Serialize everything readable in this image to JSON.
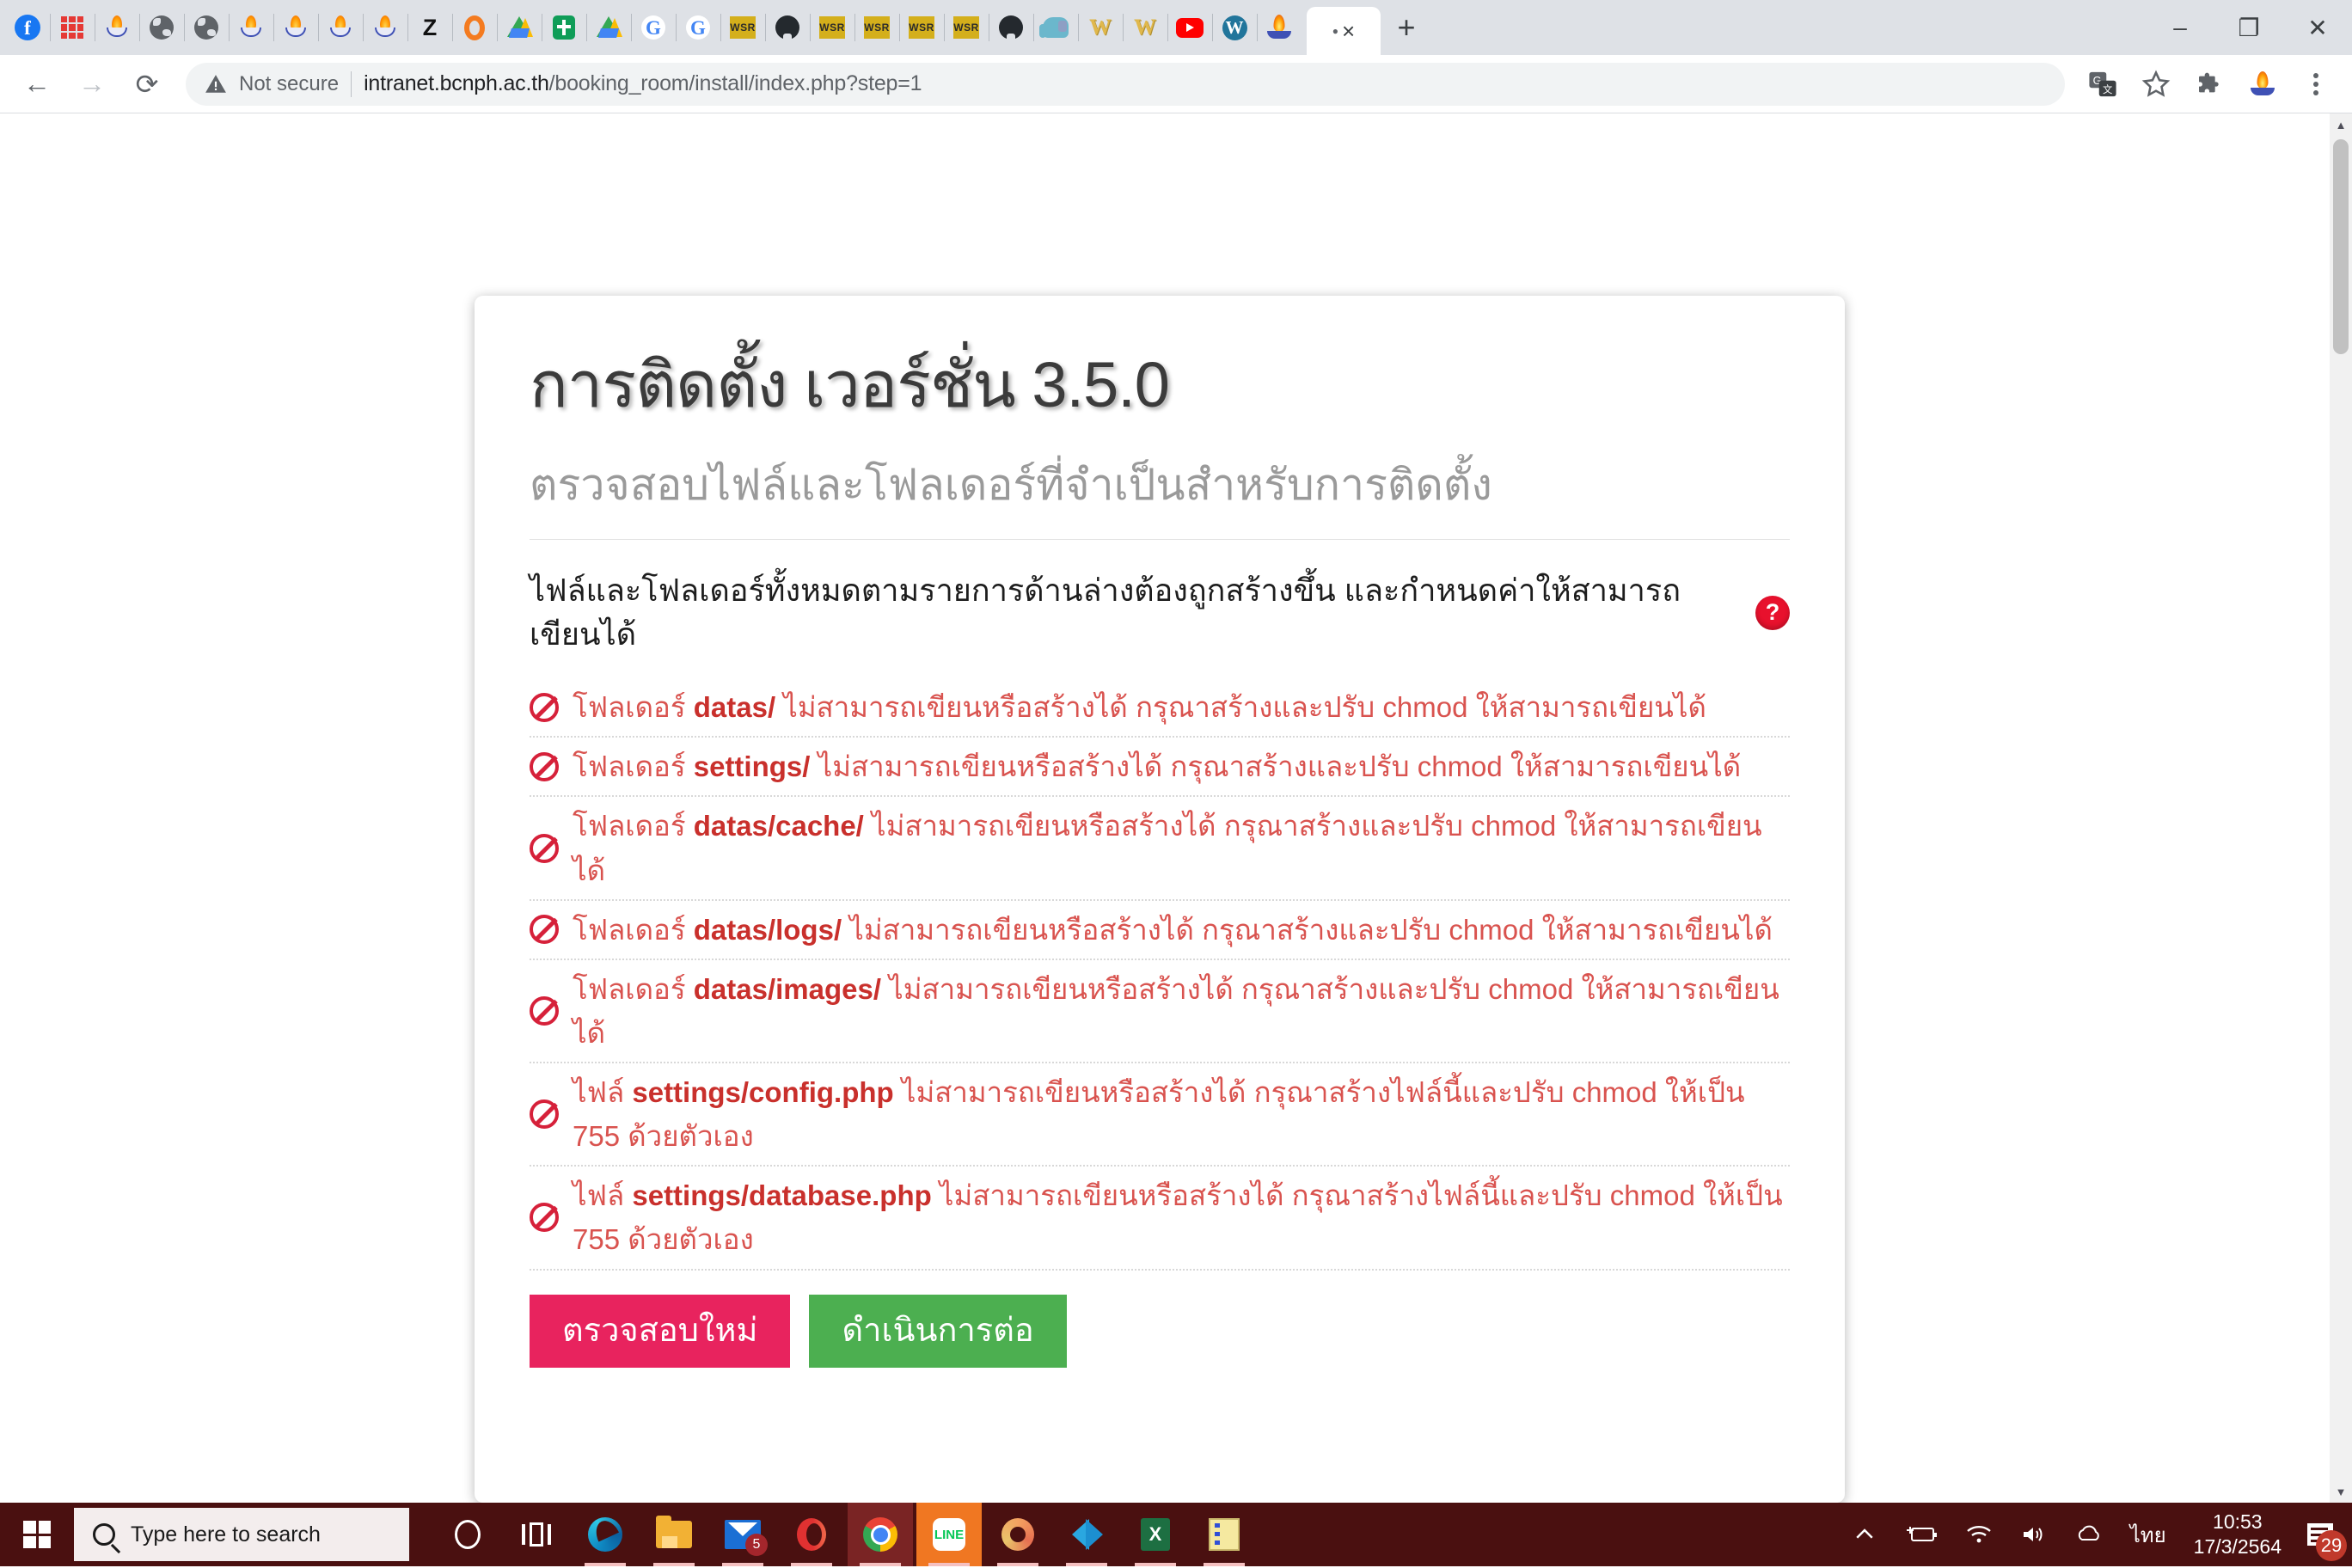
{
  "browser": {
    "pinned_tabs": [
      {
        "name": "facebook",
        "icon": "facebook-icon"
      },
      {
        "name": "grid",
        "icon": "red-grid-icon"
      },
      {
        "name": "thai-lamp-1",
        "icon": "thai-lamp-icon"
      },
      {
        "name": "globe-1",
        "icon": "globe-icon"
      },
      {
        "name": "globe-2",
        "icon": "globe-icon"
      },
      {
        "name": "thai-lamp-2",
        "icon": "thai-lamp-icon"
      },
      {
        "name": "thai-lamp-3",
        "icon": "thai-lamp-icon"
      },
      {
        "name": "thai-lamp-4",
        "icon": "thai-lamp-icon"
      },
      {
        "name": "thai-lamp-5",
        "icon": "thai-lamp-icon"
      },
      {
        "name": "zotero",
        "icon": "letter-z-icon"
      },
      {
        "name": "opera",
        "icon": "opera-o-icon"
      },
      {
        "name": "google-drive-1",
        "icon": "google-drive-icon"
      },
      {
        "name": "green-cross",
        "icon": "green-cross-icon"
      },
      {
        "name": "google-drive-2",
        "icon": "google-drive-icon"
      },
      {
        "name": "google-1",
        "icon": "google-g-icon"
      },
      {
        "name": "google-2",
        "icon": "google-g-icon"
      },
      {
        "name": "wsr-1",
        "icon": "wsr-icon",
        "label": "WSR"
      },
      {
        "name": "github-1",
        "icon": "github-icon"
      },
      {
        "name": "wsr-2",
        "icon": "wsr-icon",
        "label": "WSR"
      },
      {
        "name": "wsr-3",
        "icon": "wsr-icon",
        "label": "WSR"
      },
      {
        "name": "wsr-4",
        "icon": "wsr-icon",
        "label": "WSR"
      },
      {
        "name": "wsr-5",
        "icon": "wsr-icon",
        "label": "WSR"
      },
      {
        "name": "github-2",
        "icon": "github-icon"
      },
      {
        "name": "elephant",
        "icon": "elephant-icon"
      },
      {
        "name": "w-gold-1",
        "icon": "letter-w-icon",
        "label": "W"
      },
      {
        "name": "w-gold-2",
        "icon": "letter-w-icon",
        "label": "W"
      },
      {
        "name": "youtube",
        "icon": "youtube-icon"
      },
      {
        "name": "wordpress",
        "icon": "wordpress-icon"
      },
      {
        "name": "thai-seal",
        "icon": "thai-seal-icon"
      }
    ],
    "active_tab": {
      "close_label": "×"
    },
    "new_tab_label": "+",
    "window_controls": {
      "minimize": "–",
      "restore": "❐",
      "close": "✕"
    },
    "toolbar": {
      "back": "←",
      "forward": "→",
      "reload": "⟳",
      "security_text": "Not secure",
      "url_host": "intranet.bcnph.ac.th",
      "url_path": "/booking_room/install/index.php?step=1",
      "translate_icon": "translate-icon",
      "bookmark_icon": "star-icon",
      "extensions_icon": "puzzle-piece-icon",
      "profile_icon": "profile-seal-icon",
      "menu_icon": "three-dot-menu-icon"
    }
  },
  "page": {
    "title": "การติดตั้ง เวอร์ชั่น 3.5.0",
    "subtitle": "ตรวจสอบไฟล์และโฟลเดอร์ที่จำเป็นสำหรับการติดตั้ง",
    "lead": "ไฟล์และโฟลเดอร์ทั้งหมดตามรายการด้านล่างต้องถูกสร้างขึ้น และกำหนดค่าให้สามารถเขียนได้",
    "help_icon_label": "?",
    "checks": [
      {
        "prefix": "โฟลเดอร์ ",
        "target": "datas/",
        "suffix": " ไม่สามารถเขียนหรือสร้างได้ กรุณาสร้างและปรับ chmod ให้สามารถเขียนได้",
        "status": "denied"
      },
      {
        "prefix": "โฟลเดอร์ ",
        "target": "settings/",
        "suffix": " ไม่สามารถเขียนหรือสร้างได้ กรุณาสร้างและปรับ chmod ให้สามารถเขียนได้",
        "status": "denied"
      },
      {
        "prefix": "โฟลเดอร์ ",
        "target": "datas/cache/",
        "suffix": " ไม่สามารถเขียนหรือสร้างได้ กรุณาสร้างและปรับ chmod ให้สามารถเขียนได้",
        "status": "denied"
      },
      {
        "prefix": "โฟลเดอร์ ",
        "target": "datas/logs/",
        "suffix": " ไม่สามารถเขียนหรือสร้างได้ กรุณาสร้างและปรับ chmod ให้สามารถเขียนได้",
        "status": "denied"
      },
      {
        "prefix": "โฟลเดอร์ ",
        "target": "datas/images/",
        "suffix": " ไม่สามารถเขียนหรือสร้างได้ กรุณาสร้างและปรับ chmod ให้สามารถเขียนได้",
        "status": "denied"
      },
      {
        "prefix": "ไฟล์ ",
        "target": "settings/config.php",
        "suffix": " ไม่สามารถเขียนหรือสร้างได้ กรุณาสร้างไฟล์นี้และปรับ chmod ให้เป็น 755 ด้วยตัวเอง",
        "status": "denied"
      },
      {
        "prefix": "ไฟล์ ",
        "target": "settings/database.php",
        "suffix": " ไม่สามารถเขียนหรือสร้างได้ กรุณาสร้างไฟล์นี้และปรับ chmod ให้เป็น 755 ด้วยตัวเอง",
        "status": "denied"
      }
    ],
    "buttons": {
      "recheck": "ตรวจสอบใหม่",
      "continue": "ดำเนินการต่อ"
    },
    "colors": {
      "recheck_bg": "#e8235e",
      "continue_bg": "#4caf50",
      "error_text": "#d9534f",
      "help_badge": "#e8112d"
    }
  },
  "taskbar": {
    "start_icon": "windows-logo-icon",
    "search_placeholder": "Type here to search",
    "items": [
      {
        "name": "cortana",
        "icon": "cortana-icon"
      },
      {
        "name": "task-view",
        "icon": "task-view-icon"
      },
      {
        "name": "microsoft-edge",
        "icon": "edge-icon"
      },
      {
        "name": "file-explorer",
        "icon": "folder-icon"
      },
      {
        "name": "mail",
        "icon": "mail-icon",
        "badge": "5"
      },
      {
        "name": "opera",
        "icon": "opera-icon"
      },
      {
        "name": "google-chrome",
        "icon": "chrome-icon"
      },
      {
        "name": "line",
        "icon": "line-icon",
        "label": "LINE"
      },
      {
        "name": "photoshop",
        "icon": "photoshop-icon"
      },
      {
        "name": "visual-studio-code",
        "icon": "vscode-icon"
      },
      {
        "name": "excel",
        "icon": "excel-icon",
        "label": "X"
      },
      {
        "name": "notepad",
        "icon": "notepad-icon"
      }
    ],
    "tray": {
      "show_hidden": "show-hidden-icons-chevron",
      "battery": "battery-charging-icon",
      "network": "wifi-icon",
      "volume": "speaker-icon",
      "onedrive": "onedrive-icon",
      "language": "ไทย",
      "time": "10:53",
      "date": "17/3/2564",
      "notifications_count": "29"
    },
    "colors": {
      "background": "#4a1010",
      "line_highlight": "#f07722"
    }
  }
}
